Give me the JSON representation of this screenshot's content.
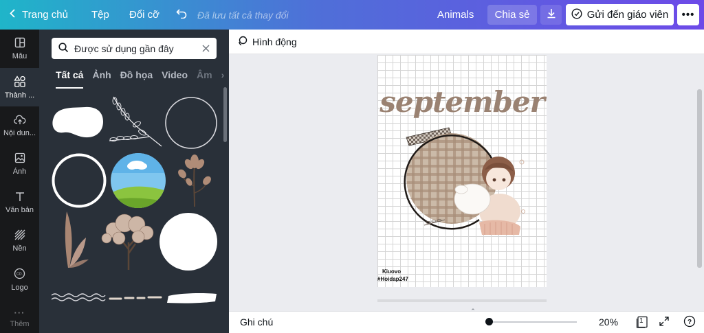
{
  "topbar": {
    "home_label": "Trang chủ",
    "file_label": "Tệp",
    "resize_label": "Đổi cỡ",
    "saved_status": "Đã lưu tất cả thay đổi",
    "design_name": "Animals",
    "share_label": "Chia sẻ",
    "send_label": "Gửi đến giáo viên",
    "more_label": "•••"
  },
  "sidebar": {
    "items": [
      {
        "label": "Mẫu",
        "icon": "templates-icon"
      },
      {
        "label": "Thành ...",
        "icon": "elements-icon"
      },
      {
        "label": "Nội dun...",
        "icon": "uploads-icon"
      },
      {
        "label": "Ảnh",
        "icon": "photos-icon"
      },
      {
        "label": "Văn bản",
        "icon": "text-icon"
      },
      {
        "label": "Nền",
        "icon": "background-icon"
      },
      {
        "label": "Logo",
        "icon": "logo-icon"
      },
      {
        "label": "Thêm",
        "icon": "more-icon"
      }
    ],
    "active_index": 1
  },
  "panel": {
    "search_placeholder": "Được sử dụng gần đây",
    "tabs": [
      "Tất cả",
      "Ảnh",
      "Đồ họa",
      "Video",
      "Âm"
    ],
    "active_tab": "Tất cả"
  },
  "context_bar": {
    "animate_label": "Hình động"
  },
  "canvas": {
    "title_text": "september",
    "watermark_line1": "Kiuovo",
    "watermark_line2": "#Hoidap247"
  },
  "bottombar": {
    "notes_label": "Ghi chú",
    "zoom": "20%",
    "page_count": "1"
  },
  "colors": {
    "topbar_start": "#1fb5c9",
    "topbar_end": "#6d4ae8",
    "panel_bg": "#293039",
    "rail_bg": "#18191b"
  }
}
